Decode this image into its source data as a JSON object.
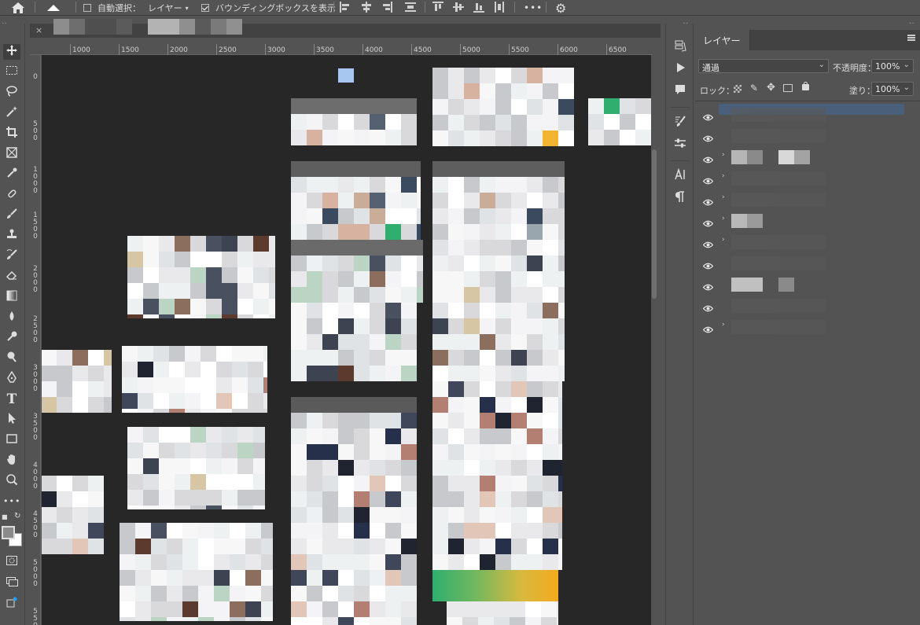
{
  "options_bar": {
    "auto_select_label": "自動選択：",
    "layer_dropdown_value": "レイヤー",
    "show_bounding_box_label": "バウンディングボックスを表示",
    "more_label": "•••"
  },
  "document_tab": {
    "close_label": "×"
  },
  "ruler": {
    "horizontal": [
      "1000",
      "1500",
      "2000",
      "2500",
      "3000",
      "3500",
      "4000",
      "4500",
      "5000",
      "5500",
      "6000",
      "6500"
    ],
    "vertical": [
      "0",
      "500",
      "1000",
      "1500",
      "2000",
      "2500",
      "3000",
      "3500",
      "4000",
      "4500",
      "5000",
      "5500"
    ]
  },
  "layers_panel": {
    "tab_label": "レイヤー",
    "blend_mode": "通過",
    "opacity_label": "不透明度：",
    "opacity_value": "100%",
    "lock_label": "ロック：",
    "fill_label": "塗り：",
    "fill_value": "100%",
    "layers": [
      {
        "visible": true,
        "group": false,
        "selected": true
      },
      {
        "visible": true,
        "group": false,
        "selected": false
      },
      {
        "visible": true,
        "group": true,
        "selected": false
      },
      {
        "visible": true,
        "group": true,
        "selected": false
      },
      {
        "visible": true,
        "group": true,
        "selected": false
      },
      {
        "visible": true,
        "group": true,
        "selected": false
      },
      {
        "visible": true,
        "group": true,
        "selected": false
      },
      {
        "visible": true,
        "group": false,
        "selected": false
      },
      {
        "visible": true,
        "group": false,
        "selected": false
      },
      {
        "visible": true,
        "group": false,
        "selected": false
      },
      {
        "visible": true,
        "group": true,
        "selected": false
      }
    ]
  },
  "colors": {
    "panel_bg": "#535353",
    "canvas_bg": "#272727",
    "selected_layer": "#4a5f7a",
    "foreground_color": "#000000",
    "background_color": "#ffffff"
  },
  "toolbar": {
    "tools": [
      "move-tool",
      "marquee-tool",
      "lasso-tool",
      "magic-wand-tool",
      "crop-tool",
      "frame-tool",
      "eyedropper-tool",
      "healing-brush-tool",
      "brush-tool",
      "clone-stamp-tool",
      "history-brush-tool",
      "eraser-tool",
      "gradient-tool",
      "blur-tool",
      "dodge-tool",
      "pen-tool",
      "type-tool",
      "path-selection-tool",
      "rectangle-tool",
      "hand-tool",
      "zoom-tool"
    ],
    "text_tool_label": "T",
    "more_label": "•••"
  }
}
